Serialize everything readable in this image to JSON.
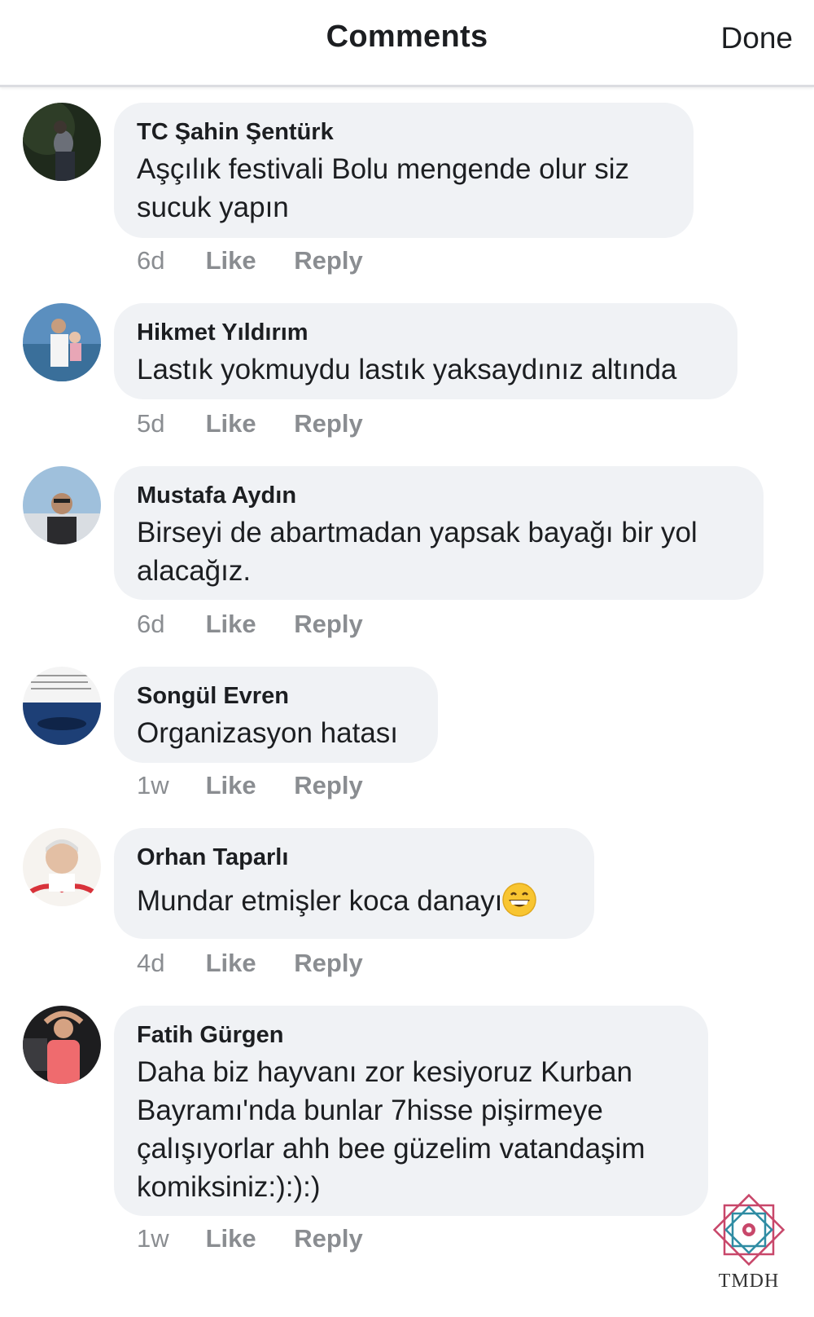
{
  "header": {
    "title": "Comments",
    "done_label": "Done"
  },
  "comments": [
    {
      "author": "TC Şahin Şentürk",
      "text": "Aşçılık festivali Bolu mengende olur siz sucuk yapın",
      "time": "6d",
      "like": "Like",
      "reply": "Reply"
    },
    {
      "author": "Hikmet Yıldırım",
      "text": "Lastık yokmuydu lastık yaksaydınız altında",
      "time": "5d",
      "like": "Like",
      "reply": "Reply"
    },
    {
      "author": "Mustafa Aydın",
      "text": "Birseyi de abartmadan yapsak bayağı bir yol alacağız.",
      "time": "6d",
      "like": "Like",
      "reply": "Reply"
    },
    {
      "author": "Songül Evren",
      "text": "Organizasyon hatası",
      "time": "1w",
      "like": "Like",
      "reply": "Reply"
    },
    {
      "author": "Orhan Taparlı",
      "text": "Mundar etmişler koca danayı",
      "emoji": "grinning-face-emoji",
      "time": "4d",
      "like": "Like",
      "reply": "Reply"
    },
    {
      "author": "Fatih Gürgen",
      "text": "Daha biz hayvanı zor kesiyoruz Kurban Bayramı'nda bunlar 7hisse pişirmeye çalışıyorlar ahh bee güzelim vatandaşim komiksiniz:):):)",
      "time": "1w",
      "like": "Like",
      "reply": "Reply"
    }
  ],
  "watermark": {
    "text": "TMDH",
    "icon": "ornamental-star-logo"
  },
  "colors": {
    "bubble": "#f0f2f5",
    "meta_text": "#8a8d91",
    "primary_text": "#1c1e21"
  }
}
